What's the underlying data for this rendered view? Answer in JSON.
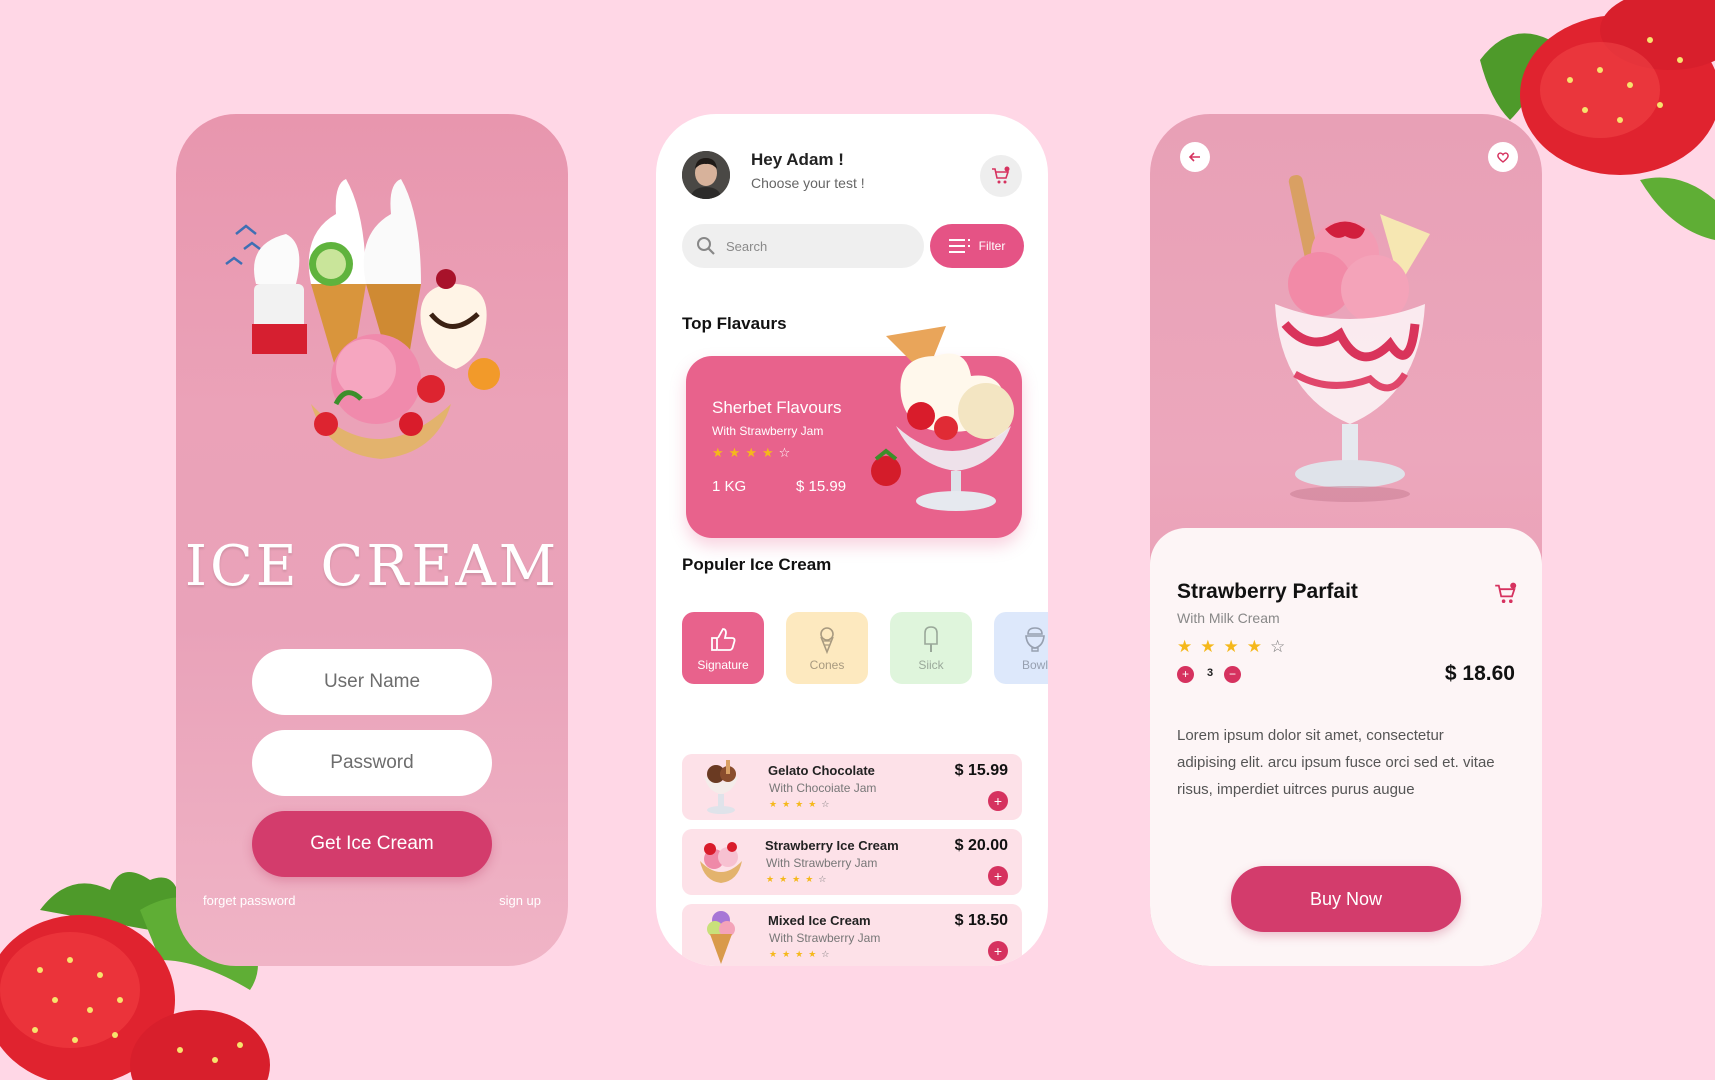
{
  "colors": {
    "background": "#ffd7e6",
    "accent": "#d33c6c",
    "accent_light": "#e8628c",
    "star": "#f5b81b",
    "star_empty": "#ffffff"
  },
  "login": {
    "brand_title": "ICE CREAM",
    "username_placeholder": "User Name",
    "password_placeholder": "Password",
    "submit_label": "Get Ice Cream",
    "forgot_label": "forget password",
    "signup_label": "sign up"
  },
  "home": {
    "greeting": "Hey Adam !",
    "greeting_sub": "Choose your test !",
    "search_placeholder": "Search",
    "filter_label": "Filter",
    "top_section_title": "Top Flavaurs",
    "featured": {
      "title": "Sherbet Flavours",
      "subtitle": "With Strawberry Jam",
      "rating": 4,
      "max_rating": 5,
      "weight": "1 KG",
      "price": "$ 15.99"
    },
    "popular_section_title": "Populer Ice Cream",
    "categories": [
      {
        "label": "Signature",
        "icon": "thumbs-up-icon",
        "active": true,
        "bg": "#e8628c",
        "fg": "#ffffff"
      },
      {
        "label": "Cones",
        "icon": "cone-icon",
        "active": false,
        "bg": "#fde9bf",
        "fg": "#a89a80"
      },
      {
        "label": "Siick",
        "icon": "popsicle-icon",
        "active": false,
        "bg": "#dff5dc",
        "fg": "#9aa89a"
      },
      {
        "label": "Bowl",
        "icon": "bowl-icon",
        "active": false,
        "bg": "#dde8fb",
        "fg": "#97a0b0"
      }
    ],
    "items": [
      {
        "name": "Gelato Chocolate",
        "subtitle": "With Chocoiate Jam",
        "price": "$ 15.99",
        "rating": 4
      },
      {
        "name": "Strawberry Ice Cream",
        "subtitle": "With Strawberry Jam",
        "price": "$ 20.00",
        "rating": 4
      },
      {
        "name": "Mixed Ice Cream",
        "subtitle": "With Strawberry Jam",
        "price": "$ 18.50",
        "rating": 4
      }
    ]
  },
  "detail": {
    "title": "Strawberry Parfait",
    "subtitle": "With Milk Cream",
    "rating": 4,
    "quantity": "3",
    "price": "$ 18.60",
    "description": "Lorem ipsum dolor sit amet, consectetur adipising elit. arcu ipsum fusce orci sed et. vitae risus, imperdiet uitrces purus augue",
    "buy_label": "Buy Now"
  }
}
